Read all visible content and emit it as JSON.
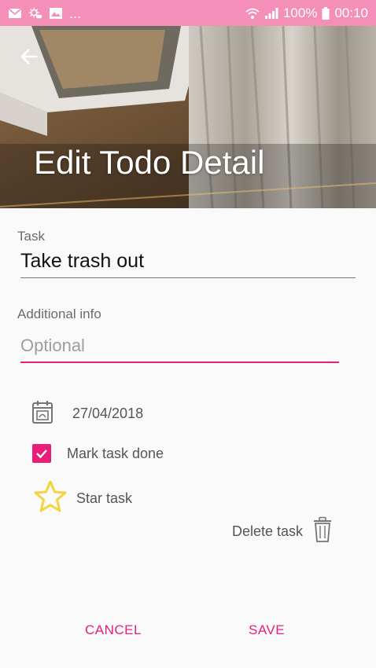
{
  "status_bar": {
    "notifications": [
      "mail-icon",
      "weather-icon",
      "gallery-icon"
    ],
    "more": "...",
    "battery": "100%",
    "time": "00:10"
  },
  "header": {
    "title": "Edit Todo Detail"
  },
  "form": {
    "task_label": "Task",
    "task_value": "Take trash out",
    "info_label": "Additional info",
    "info_placeholder": "Optional",
    "info_value": "",
    "date": "27/04/2018",
    "done_label": "Mark task done",
    "done_checked": true,
    "star_label": "Star task",
    "delete_label": "Delete task"
  },
  "actions": {
    "cancel": "CANCEL",
    "save": "SAVE"
  },
  "colors": {
    "accent": "#e91e7a",
    "status_bar": "#f48fb8",
    "star": "#f5d442"
  }
}
